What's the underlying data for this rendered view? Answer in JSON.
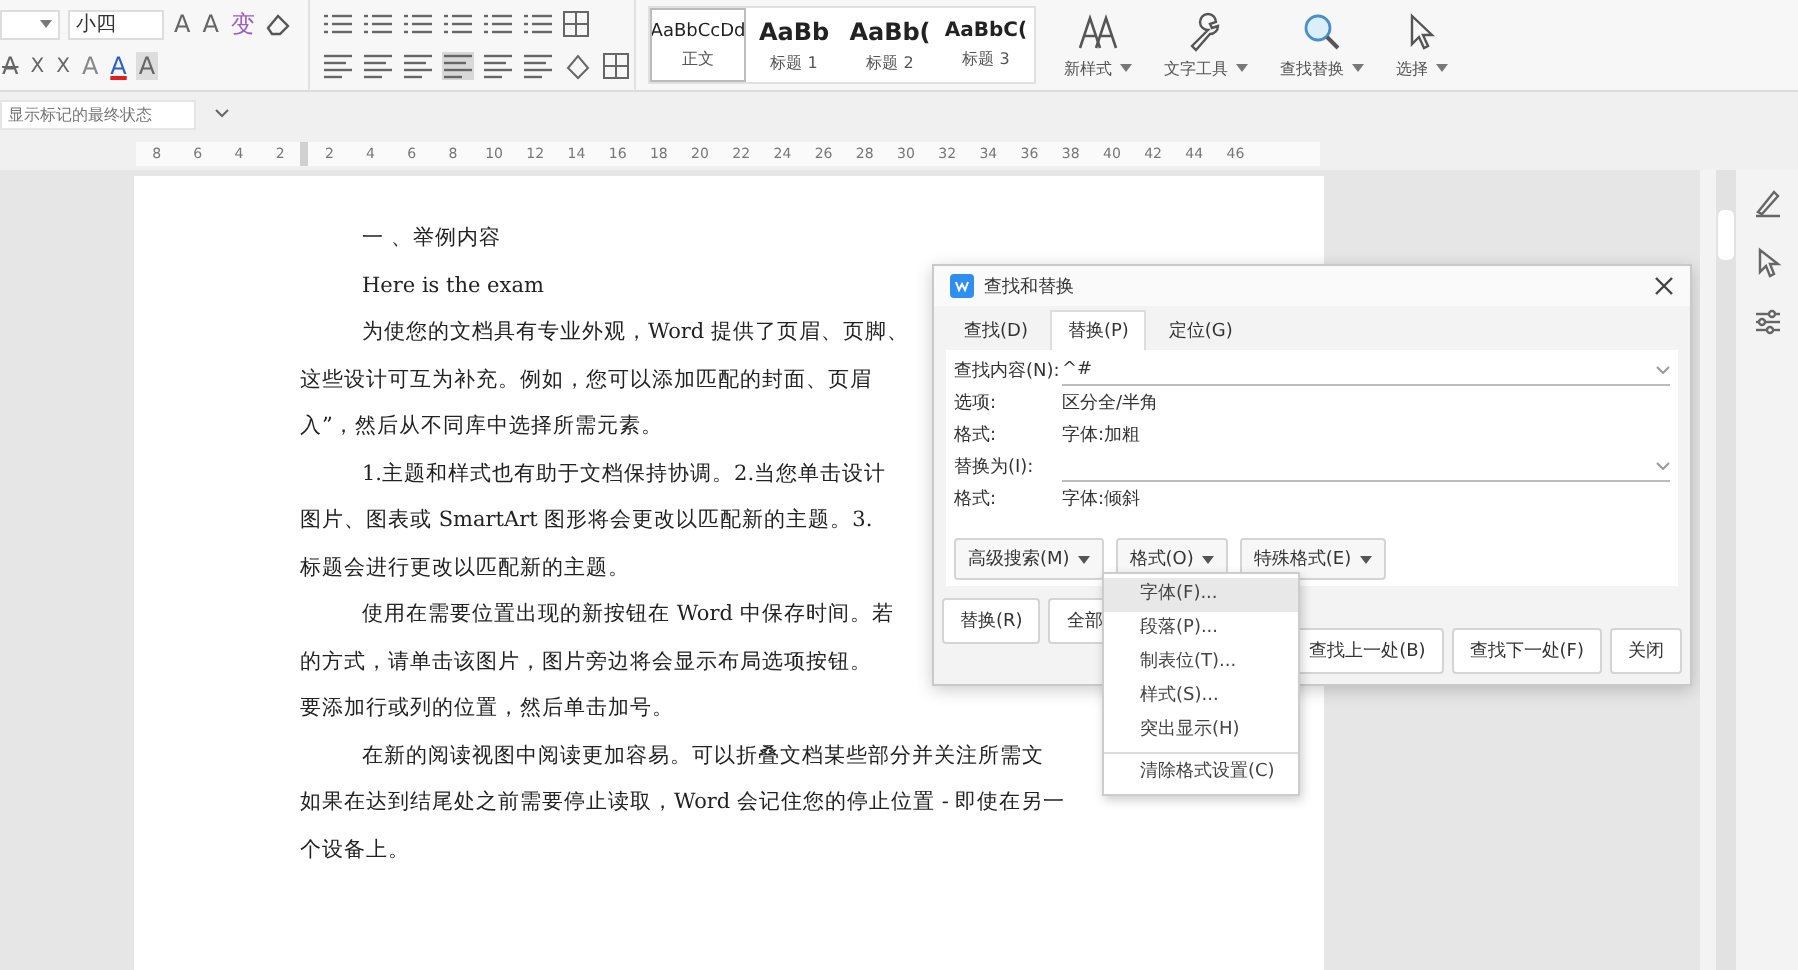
{
  "toolbar": {
    "font_size": "小四",
    "font_row1": [
      {
        "glyph": "A",
        "kind": "grow"
      },
      {
        "glyph": "A",
        "kind": "shrink"
      },
      {
        "glyph": "变",
        "kind": "plain"
      }
    ],
    "font_row2": [
      {
        "glyph": "A",
        "kind": "strike"
      },
      {
        "glyph": "X",
        "kind": "super"
      },
      {
        "glyph": "X",
        "kind": "sub"
      },
      {
        "glyph": "A",
        "kind": "outline"
      },
      {
        "glyph": "A",
        "kind": "color"
      },
      {
        "glyph": "A",
        "kind": "shade"
      }
    ],
    "styles": [
      {
        "preview": "AaBbCcDd",
        "label": "正文",
        "selected": true,
        "kind": "body"
      },
      {
        "preview": "AaBb",
        "label": "标题 1",
        "selected": false,
        "kind": "heading"
      },
      {
        "preview": "AaBb(",
        "label": "标题 2",
        "selected": false,
        "kind": "heading"
      },
      {
        "preview": "AaBbC(",
        "label": "标题 3",
        "selected": false,
        "kind": "heading2"
      }
    ],
    "tools": [
      {
        "label": "新样式",
        "kind": "styles"
      },
      {
        "label": "文字工具",
        "kind": "wrench"
      },
      {
        "label": "查找替换",
        "kind": "search"
      },
      {
        "label": "选择",
        "kind": "cursor"
      }
    ]
  },
  "track_changes": {
    "value": "显示标记的最终状态"
  },
  "ruler": {
    "left_labels": [
      "8",
      "6",
      "4",
      "2"
    ],
    "right_labels": [
      "2",
      "4",
      "6",
      "8",
      "10",
      "12",
      "14",
      "16",
      "18",
      "20",
      "22",
      "24",
      "26",
      "28",
      "30",
      "32",
      "34",
      "36",
      "38",
      "40",
      "42",
      "44",
      "46"
    ]
  },
  "document": {
    "lines": [
      {
        "text": "一 、举例内容",
        "indent": true
      },
      {
        "text": "Here is the exam",
        "indent": true
      },
      {
        "text": "为使您的文档具有专业外观，Word 提供了页眉、页脚、",
        "indent": true
      },
      {
        "text": "这些设计可互为补充。例如，您可以添加匹配的封面、页眉",
        "indent": false
      },
      {
        "text": "入”，然后从不同库中选择所需元素。",
        "indent": false
      },
      {
        "text": "1.主题和样式也有助于文档保持协调。2.当您单击设计",
        "indent": true
      },
      {
        "text": "图片、图表或 SmartArt 图形将会更改以匹配新的主题。3.",
        "indent": false
      },
      {
        "text": "标题会进行更改以匹配新的主题。",
        "indent": false
      },
      {
        "text": "使用在需要位置出现的新按钮在 Word 中保存时间。若",
        "indent": true
      },
      {
        "text": "的方式，请单击该图片，图片旁边将会显示布局选项按钮。",
        "indent": false
      },
      {
        "text": "要添加行或列的位置，然后单击加号。",
        "indent": false
      },
      {
        "text": "在新的阅读视图中阅读更加容易。可以折叠文档某些部分并关注所需文",
        "indent": true
      },
      {
        "text": "如果在达到结尾处之前需要停止读取，Word 会记住您的停止位置 - 即使在另一",
        "indent": false
      },
      {
        "text": "个设备上。",
        "indent": false
      }
    ]
  },
  "dialog": {
    "title": "查找和替换",
    "tabs": [
      {
        "label": "查找(D)",
        "selected": false
      },
      {
        "label": "替换(P)",
        "selected": true
      },
      {
        "label": "定位(G)",
        "selected": false
      }
    ],
    "find": {
      "label": "查找内容(N):",
      "value": "^#"
    },
    "find_info": [
      {
        "label": "选项:",
        "value": "区分全/半角"
      },
      {
        "label": "格式:",
        "value": "字体:加粗"
      }
    ],
    "replace": {
      "label": "替换为(I):"
    },
    "replace_info": [
      {
        "label": "格式:",
        "value": "字体:倾斜"
      }
    ],
    "option_buttons": [
      "高级搜索(M)",
      "格式(O)",
      "特殊格式(E)"
    ],
    "left_buttons": [
      "替换(R)",
      "全部"
    ],
    "right_buttons": [
      "查找上一处(B)",
      "查找下一处(F)",
      "关闭"
    ],
    "menu": [
      {
        "label": "字体(F)...",
        "selected": true,
        "separator_before": false
      },
      {
        "label": "段落(P)...",
        "selected": false,
        "separator_before": false
      },
      {
        "label": "制表位(T)...",
        "selected": false,
        "separator_before": false
      },
      {
        "label": "样式(S)...",
        "selected": false,
        "separator_before": false
      },
      {
        "label": "突出显示(H)",
        "selected": false,
        "separator_before": false
      },
      {
        "label": "清除格式设置(C)",
        "selected": false,
        "separator_before": true
      }
    ]
  }
}
